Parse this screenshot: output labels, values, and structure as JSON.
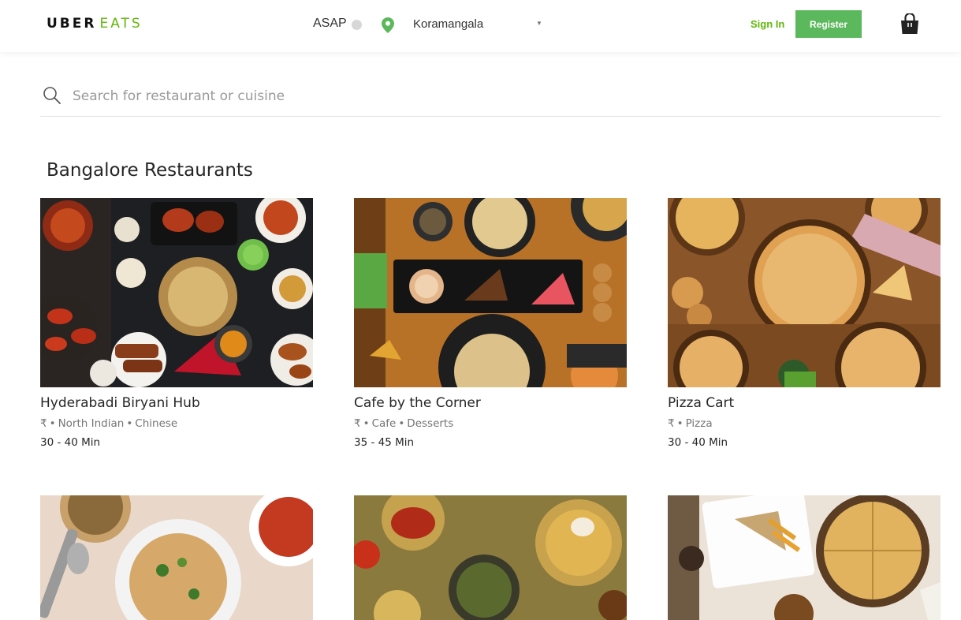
{
  "header": {
    "logo_uber": "UBER",
    "logo_eats": "EATS",
    "asap_label": "ASAP",
    "location": "Koramangala",
    "signin_label": "Sign In",
    "register_label": "Register",
    "cart_icon": "shopping-bag-icon",
    "pin_icon": "location-pin-icon",
    "clock_icon": "clock-icon",
    "brand_color": "#5fb709"
  },
  "search": {
    "placeholder": "Search for restaurant or cuisine",
    "icon": "search-icon"
  },
  "section": {
    "title": "Bangalore Restaurants"
  },
  "restaurants": [
    {
      "name": "Hyderabadi Biryani Hub",
      "price": "₹",
      "cuisines": [
        "North Indian",
        "Chinese"
      ],
      "time": "30 - 40 Min"
    },
    {
      "name": "Cafe by the Corner",
      "price": "₹",
      "cuisines": [
        "Cafe",
        "Desserts"
      ],
      "time": "35 - 45 Min"
    },
    {
      "name": "Pizza Cart",
      "price": "₹",
      "cuisines": [
        "Pizza"
      ],
      "time": "30 - 40 Min"
    },
    {
      "name": "",
      "price": "",
      "cuisines": [],
      "time": ""
    },
    {
      "name": "",
      "price": "",
      "cuisines": [],
      "time": ""
    },
    {
      "name": "",
      "price": "",
      "cuisines": [],
      "time": ""
    }
  ]
}
